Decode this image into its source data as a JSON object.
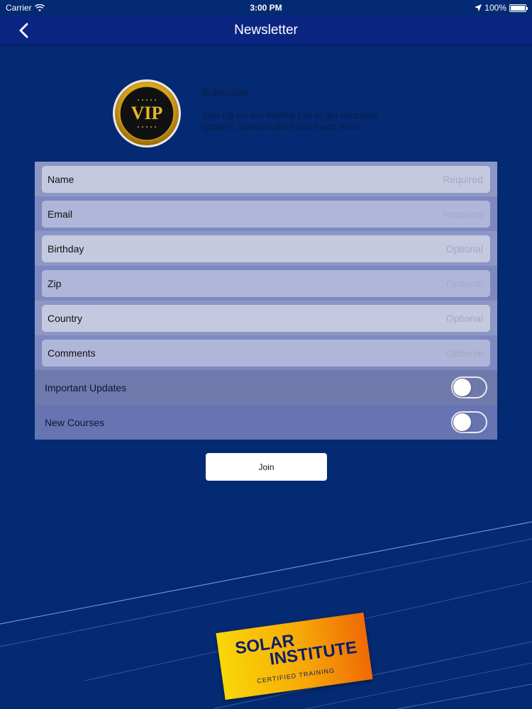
{
  "status_bar": {
    "carrier": "Carrier",
    "time": "3:00 PM",
    "battery": "100%"
  },
  "nav": {
    "title": "Newsletter"
  },
  "header": {
    "badge_text": "VIP",
    "title": "Subscribe",
    "description": "Sign Up for our Mailing List to get exclusive updates, special offers and much more."
  },
  "form": {
    "fields": [
      {
        "label": "Name",
        "placeholder": "Required",
        "value": ""
      },
      {
        "label": "Email",
        "placeholder": "Required",
        "value": ""
      },
      {
        "label": "Birthday",
        "placeholder": "Optional",
        "value": ""
      },
      {
        "label": "Zip",
        "placeholder": "Optional",
        "value": ""
      },
      {
        "label": "Country",
        "placeholder": "Optional",
        "value": ""
      },
      {
        "label": "Comments",
        "placeholder": "Optional",
        "value": ""
      }
    ],
    "toggles": [
      {
        "label": "Important Updates",
        "on": false
      },
      {
        "label": "New Courses",
        "on": false
      }
    ],
    "join_label": "Join"
  },
  "logo": {
    "line1": "SOLAR",
    "line2": "INSTITUTE",
    "line3": "CERTIFIED TRAINING"
  },
  "colors": {
    "background": "#032a72",
    "nav": "#0a2581",
    "logo_yellow": "#f9d708",
    "logo_orange": "#ee6a05"
  }
}
